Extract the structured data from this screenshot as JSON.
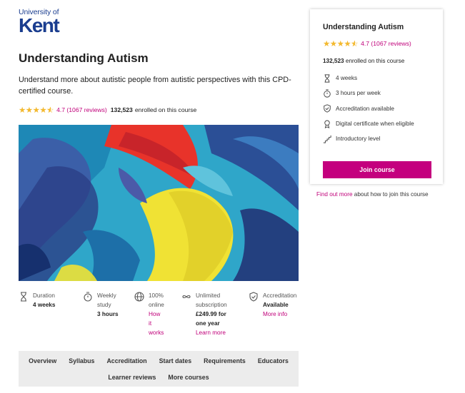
{
  "logo": {
    "line1": "University of",
    "line2": "Kent"
  },
  "course": {
    "title": "Understanding Autism",
    "description": "Understand more about autistic people from autistic perspectives with this CPD-certified course.",
    "rating": "4.7",
    "reviews": "(1067 reviews)",
    "enrolled_count": "132,523",
    "enrolled_text": "enrolled on this course"
  },
  "facts": [
    {
      "icon": "hourglass-icon",
      "label": "Duration",
      "value": "4 weeks"
    },
    {
      "icon": "stopwatch-icon",
      "label": "Weekly study",
      "value": "3 hours"
    },
    {
      "icon": "globe-icon",
      "label": "100% online",
      "link": "How it works"
    },
    {
      "icon": "infinity-icon",
      "label": "Unlimited subscription",
      "value": "£249.99 for one year",
      "link": "Learn more"
    },
    {
      "icon": "badge-check-icon",
      "label": "Accreditation",
      "value": "Available",
      "link": "More info"
    }
  ],
  "tabs": {
    "row1": [
      "Overview",
      "Syllabus",
      "Accreditation",
      "Start dates",
      "Requirements",
      "Educators"
    ],
    "row2": [
      "Learner reviews",
      "More courses"
    ]
  },
  "card": {
    "title": "Understanding Autism",
    "rating": "4.7",
    "reviews": "(1067 reviews)",
    "enrolled_count": "132,523",
    "enrolled_text": "enrolled on this course",
    "items": [
      {
        "icon": "hourglass-icon",
        "text": "4 weeks"
      },
      {
        "icon": "stopwatch-icon",
        "text": "3 hours per week"
      },
      {
        "icon": "badge-check-icon",
        "text": "Accreditation available"
      },
      {
        "icon": "certificate-icon",
        "text": "Digital certificate when eligible"
      },
      {
        "icon": "steps-icon",
        "text": "Introductory level"
      }
    ],
    "join_label": "Join course"
  },
  "find_out": {
    "link": "Find out more",
    "text": "about how to join this course"
  },
  "colors": {
    "accent": "#c4007e",
    "brand": "#1a3d8f",
    "star": "#f3b92f"
  }
}
